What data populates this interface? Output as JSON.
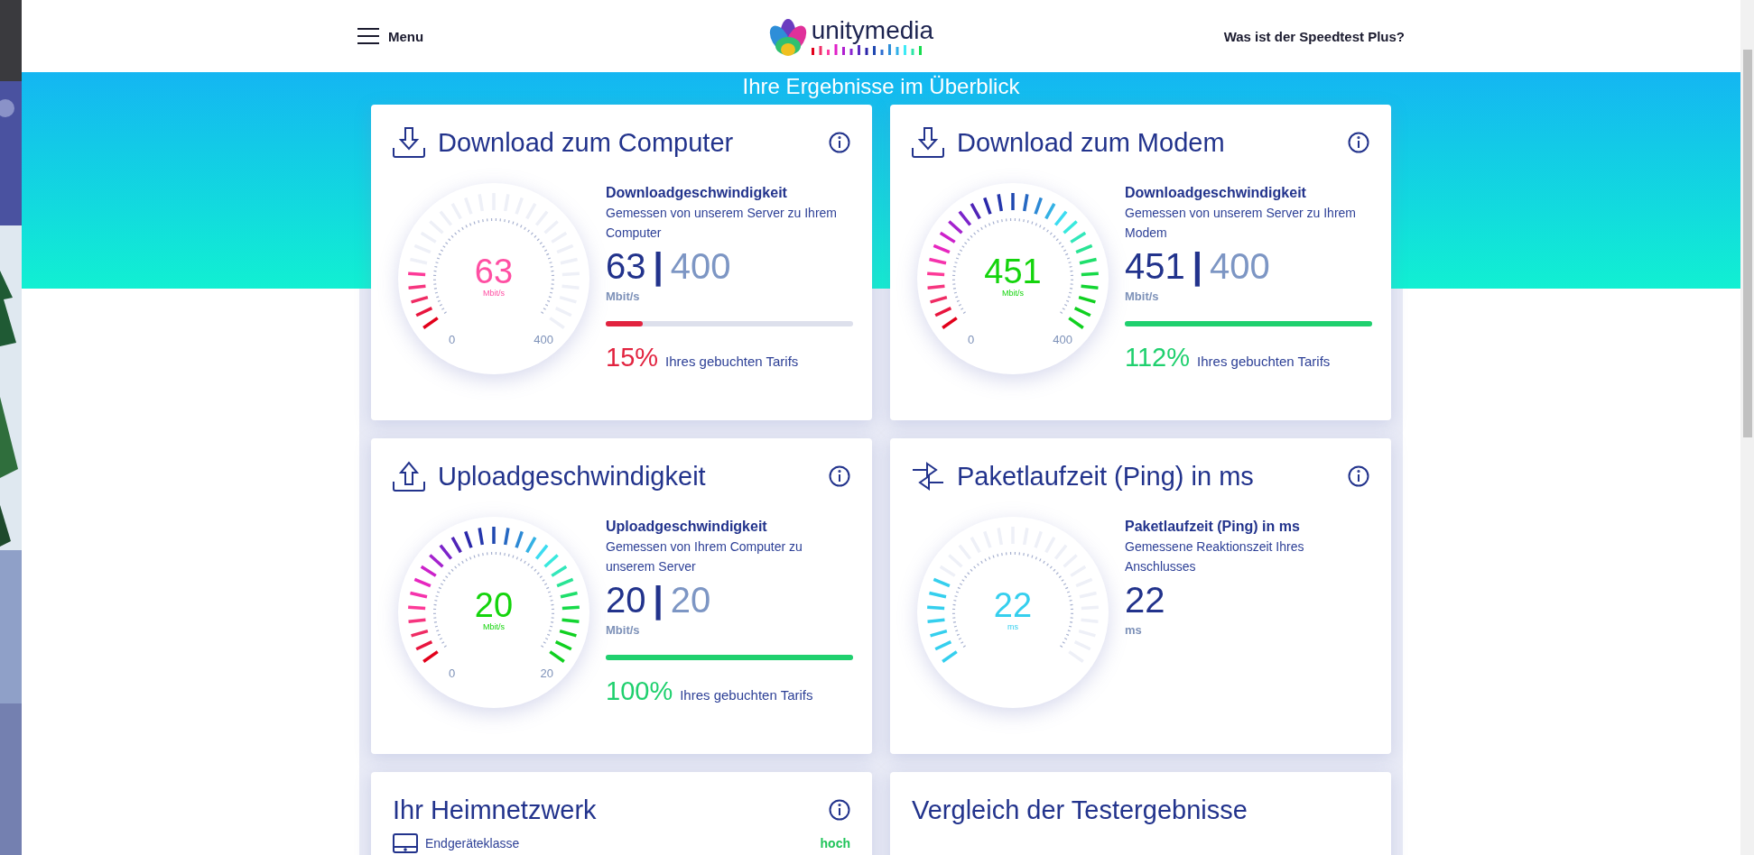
{
  "header": {
    "menu_label": "Menu",
    "logo_text": "unitymedia",
    "help_link": "Was ist der Speedtest Plus?"
  },
  "band_title": "Ihre Ergebnisse im Überblick",
  "cards": [
    {
      "kind": "download",
      "title": "Download zum Computer",
      "heading": "Downloadgeschwindigkeit",
      "description": "Gemessen von unserem Server zu Ihrem Computer",
      "reading": "63",
      "separator": "|",
      "target": "400",
      "unit": "Mbit/s",
      "gauge": {
        "reading": "63",
        "unit": "Mbit/s",
        "min": "0",
        "max": "400",
        "kind": "spectrum",
        "ticks": [
          {
            "on": true
          },
          {
            "on": true
          },
          {
            "on": true
          },
          {
            "on": true
          },
          {
            "on": true
          },
          {
            "on": false
          },
          {
            "on": false
          },
          {
            "on": false
          },
          {
            "on": false
          },
          {
            "on": false
          },
          {
            "on": false
          },
          {
            "on": false
          },
          {
            "on": false
          },
          {
            "on": false
          },
          {
            "on": false
          },
          {
            "on": false
          },
          {
            "on": false
          },
          {
            "on": false
          },
          {
            "on": false
          },
          {
            "on": false
          },
          {
            "on": false
          },
          {
            "on": false
          },
          {
            "on": false
          },
          {
            "on": false
          },
          {
            "on": false
          },
          {
            "on": false
          },
          {
            "on": false
          }
        ],
        "color": "#ff4fa3"
      },
      "progress": {
        "level": 0.15,
        "color": "#e2233f"
      },
      "percent": {
        "text": "15%",
        "color": "#e2233f"
      },
      "percent_label": "Ihres gebuchten Tarifs"
    },
    {
      "kind": "download",
      "title": "Download zum Modem",
      "heading": "Downloadgeschwindigkeit",
      "description": "Gemessen von unserem Server zu Ihrem Modem",
      "reading": "451",
      "separator": "|",
      "target": "400",
      "unit": "Mbit/s",
      "gauge": {
        "reading": "451",
        "unit": "Mbit/s",
        "min": "0",
        "max": "400",
        "kind": "spectrum",
        "ticks": [
          {
            "on": true
          },
          {
            "on": true
          },
          {
            "on": true
          },
          {
            "on": true
          },
          {
            "on": true
          },
          {
            "on": true
          },
          {
            "on": true
          },
          {
            "on": true
          },
          {
            "on": true
          },
          {
            "on": true
          },
          {
            "on": true
          },
          {
            "on": true
          },
          {
            "on": true
          },
          {
            "on": true
          },
          {
            "on": true
          },
          {
            "on": true
          },
          {
            "on": true
          },
          {
            "on": true
          },
          {
            "on": true
          },
          {
            "on": true
          },
          {
            "on": true
          },
          {
            "on": true
          },
          {
            "on": true
          },
          {
            "on": true
          },
          {
            "on": true
          },
          {
            "on": true
          },
          {
            "on": true
          }
        ],
        "color": "#14d40c"
      },
      "progress": {
        "level": 1,
        "color": "#1fd06e"
      },
      "percent": {
        "text": "112%",
        "color": "#1fd06e"
      },
      "percent_label": "Ihres gebuchten Tarifs"
    },
    {
      "kind": "upload",
      "title": "Uploadgeschwindigkeit",
      "heading": "Uploadgeschwindigkeit",
      "description": "Gemessen von Ihrem Computer zu unserem Server",
      "reading": "20",
      "separator": "|",
      "target": "20",
      "unit": "Mbit/s",
      "gauge": {
        "reading": "20",
        "unit": "Mbit/s",
        "min": "0",
        "max": "20",
        "kind": "spectrum",
        "ticks": [
          {
            "on": true
          },
          {
            "on": true
          },
          {
            "on": true
          },
          {
            "on": true
          },
          {
            "on": true
          },
          {
            "on": true
          },
          {
            "on": true
          },
          {
            "on": true
          },
          {
            "on": true
          },
          {
            "on": true
          },
          {
            "on": true
          },
          {
            "on": true
          },
          {
            "on": true
          },
          {
            "on": true
          },
          {
            "on": true
          },
          {
            "on": true
          },
          {
            "on": true
          },
          {
            "on": true
          },
          {
            "on": true
          },
          {
            "on": true
          },
          {
            "on": true
          },
          {
            "on": true
          },
          {
            "on": true
          },
          {
            "on": true
          },
          {
            "on": true
          },
          {
            "on": true
          },
          {
            "on": true
          }
        ],
        "color": "#14d40c"
      },
      "progress": {
        "level": 1,
        "color": "#1fd06e"
      },
      "percent": {
        "text": "100%",
        "color": "#1fd06e"
      },
      "percent_label": "Ihres gebuchten Tarifs"
    },
    {
      "kind": "ping",
      "title": "Paketlaufzeit (Ping) in ms",
      "heading": "Paketlaufzeit (Ping) in ms",
      "description": "Gemessene Reaktionszeit Ihres Anschlusses",
      "reading": "22",
      "unit": "ms",
      "gauge": {
        "reading": "22",
        "unit": "ms",
        "kind": "solid",
        "ticks": [
          {
            "on": true
          },
          {
            "on": true
          },
          {
            "on": true
          },
          {
            "on": true
          },
          {
            "on": true
          },
          {
            "on": true
          },
          {
            "on": true
          },
          {
            "on": false
          },
          {
            "on": false
          },
          {
            "on": false
          },
          {
            "on": false
          },
          {
            "on": false
          },
          {
            "on": false
          },
          {
            "on": false
          },
          {
            "on": false
          },
          {
            "on": false
          },
          {
            "on": false
          },
          {
            "on": false
          },
          {
            "on": false
          },
          {
            "on": false
          },
          {
            "on": false
          },
          {
            "on": false
          },
          {
            "on": false
          },
          {
            "on": false
          },
          {
            "on": false
          },
          {
            "on": false
          },
          {
            "on": false
          }
        ],
        "color": "#35cfee"
      }
    }
  ],
  "home_network": {
    "title": "Ihr Heimnetzwerk",
    "rows": [
      {
        "label": "Endgeräteklasse",
        "value": "hoch"
      }
    ]
  },
  "comparison": {
    "title": "Vergleich der Testergebnisse"
  }
}
